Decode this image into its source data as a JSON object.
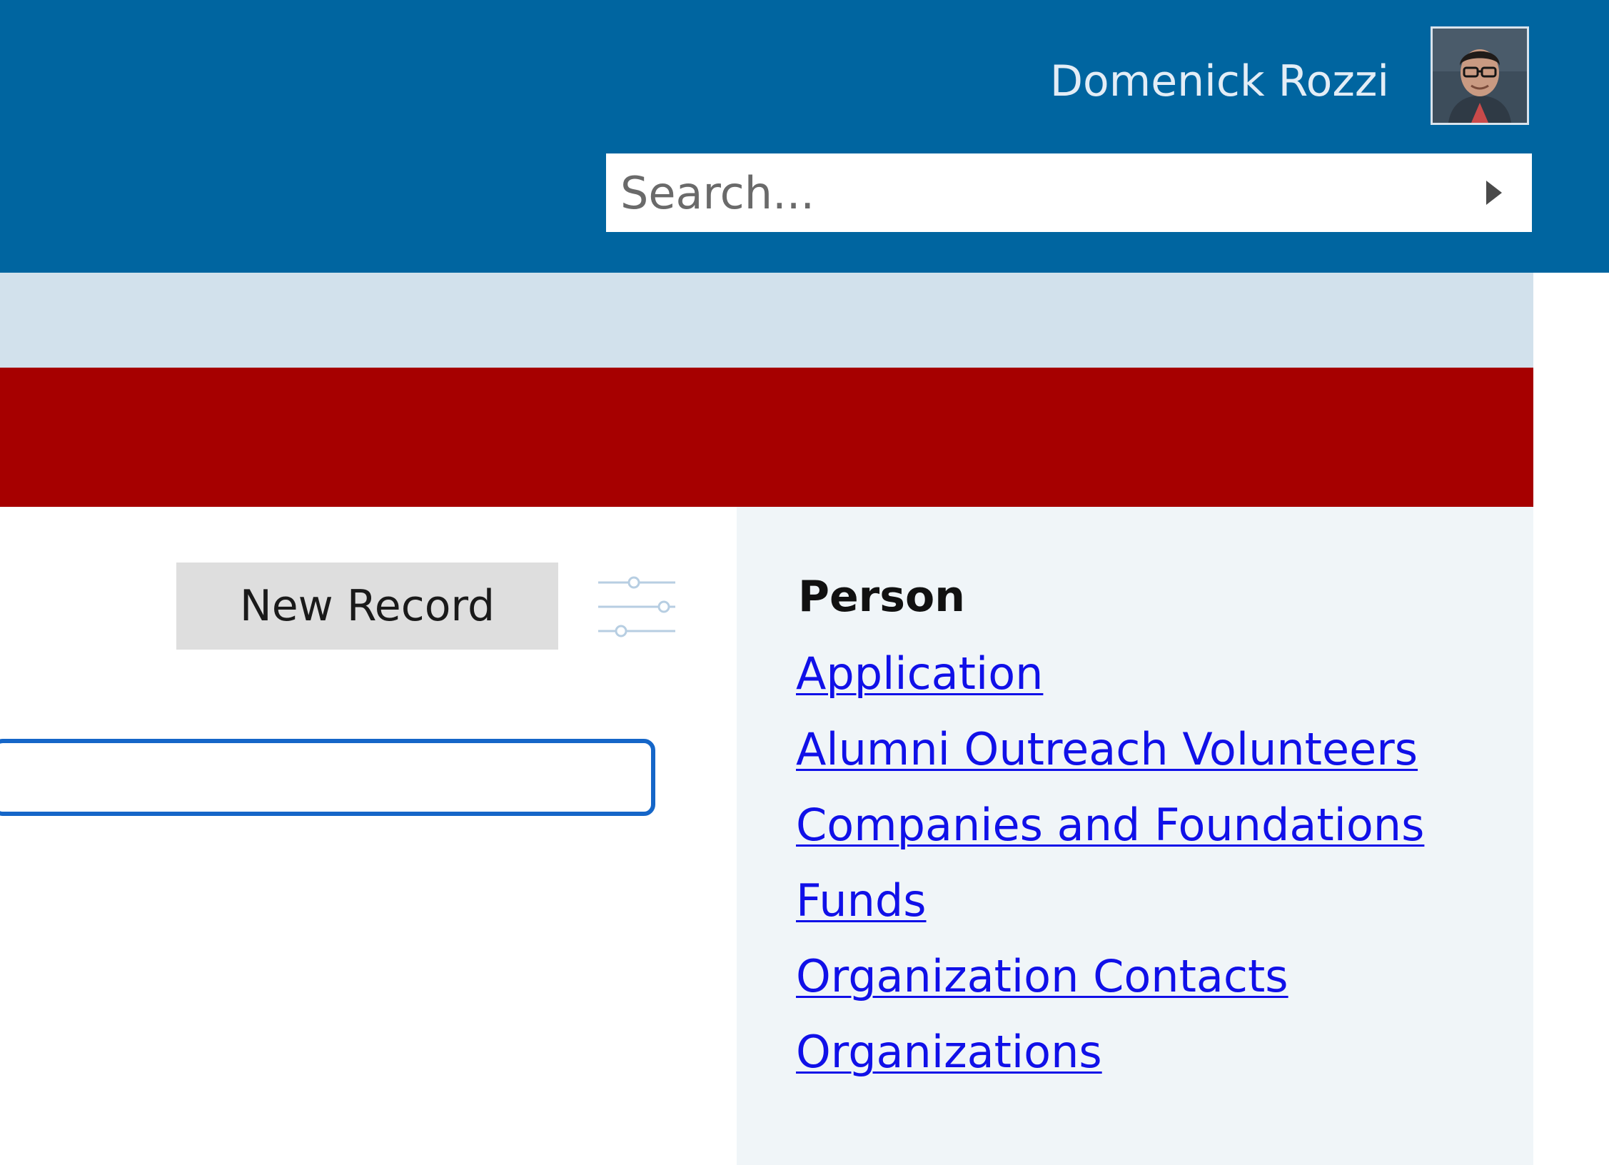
{
  "header": {
    "user_name": "Domenick Rozzi",
    "avatar_alt": "Domenick Rozzi",
    "search": {
      "placeholder": "Search...",
      "value": ""
    },
    "search_go_icon": "triangle-right-icon"
  },
  "toolbar": {
    "new_record_label": "New Record",
    "filter_icon": "sliders-icon"
  },
  "record_panel": {
    "heading": "Person",
    "links": [
      "Application",
      "Alumni Outreach Volunteers",
      "Companies and Foundations",
      "Funds",
      "Organization Contacts",
      "Organizations"
    ]
  },
  "colors": {
    "header_bg": "#0065a0",
    "subnav_bg": "#d2e1ec",
    "accent_red": "#a60000",
    "panel_bg": "#f0f5f8",
    "link": "#1010e8",
    "input_border": "#1566c8"
  }
}
